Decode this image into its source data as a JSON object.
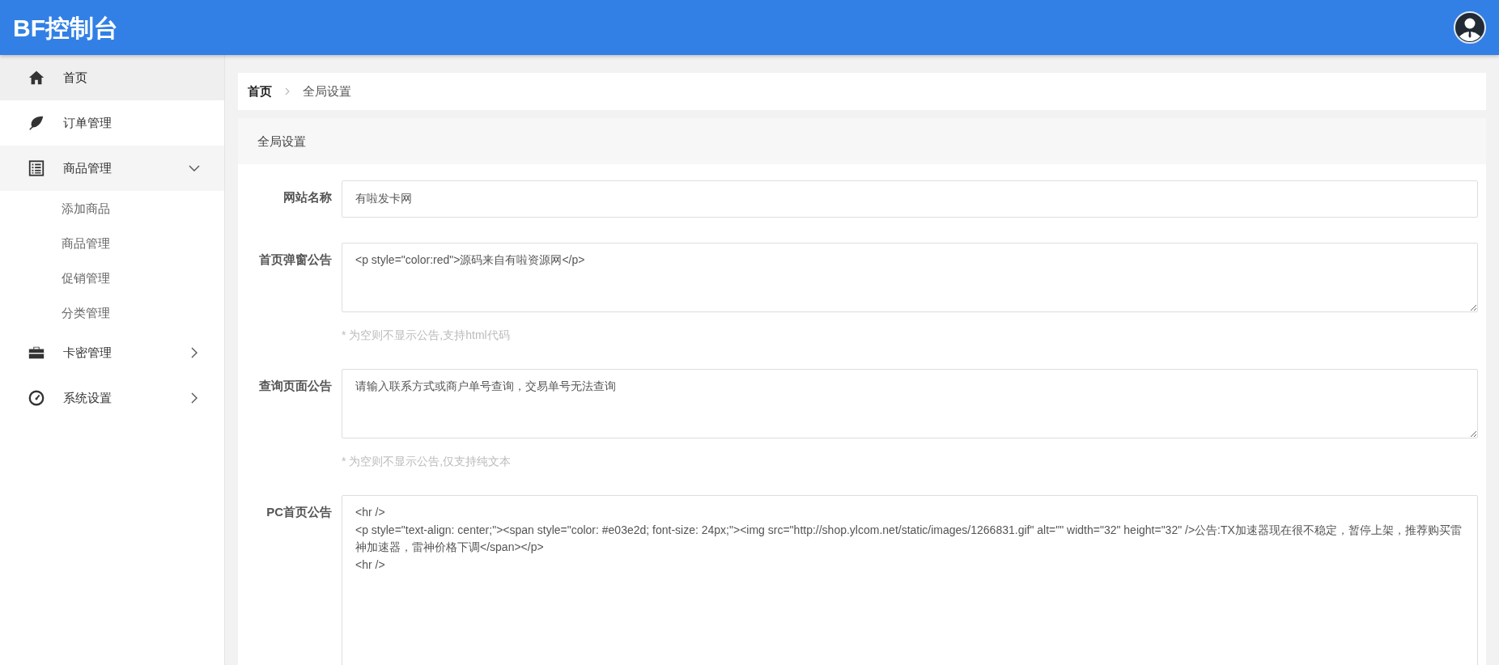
{
  "header": {
    "title": "BF控制台"
  },
  "sidebar": {
    "items": [
      {
        "label": "首页",
        "kind": "link",
        "selected": true
      },
      {
        "label": "订单管理",
        "kind": "link",
        "selected": false
      },
      {
        "label": "商品管理",
        "kind": "group",
        "selected": false,
        "expanded": true,
        "children": [
          {
            "label": "添加商品",
            "selected": false
          },
          {
            "label": "商品管理",
            "selected": false
          },
          {
            "label": "促销管理",
            "selected": false
          },
          {
            "label": "分类管理",
            "selected": false
          }
        ]
      },
      {
        "label": "卡密管理",
        "kind": "group",
        "selected": false,
        "expanded": false
      },
      {
        "label": "系统设置",
        "kind": "group",
        "selected": false,
        "expanded": false
      }
    ]
  },
  "breadcrumb": [
    "首页",
    "全局设置"
  ],
  "card": {
    "title": "全局设置",
    "fields": [
      {
        "kind": "input",
        "label": "网站名称",
        "value": "有啦发卡网"
      },
      {
        "kind": "textarea",
        "label": "首页弹窗公告",
        "value": "<p style=\"color:red\">源码来自有啦资源网</p>",
        "help": "* 为空则不显示公告,支持html代码"
      },
      {
        "kind": "textarea",
        "label": "查询页面公告",
        "value": "请输入联系方式或商户单号查询，交易单号无法查询",
        "help": "* 为空则不显示公告,仅支持纯文本"
      },
      {
        "kind": "tall",
        "label": "PC首页公告",
        "value": "<hr />\n<p style=\"text-align: center;\"><span style=\"color: #e03e2d; font-size: 24px;\"><img src=\"http://shop.ylcom.net/static/images/1266831.gif\" alt=\"\" width=\"32\" height=\"32\" />公告:TX加速器现在很不稳定，暂停上架，推荐购买雷神加速器，雷神价格下调</span></p>\n<hr />"
      }
    ]
  }
}
